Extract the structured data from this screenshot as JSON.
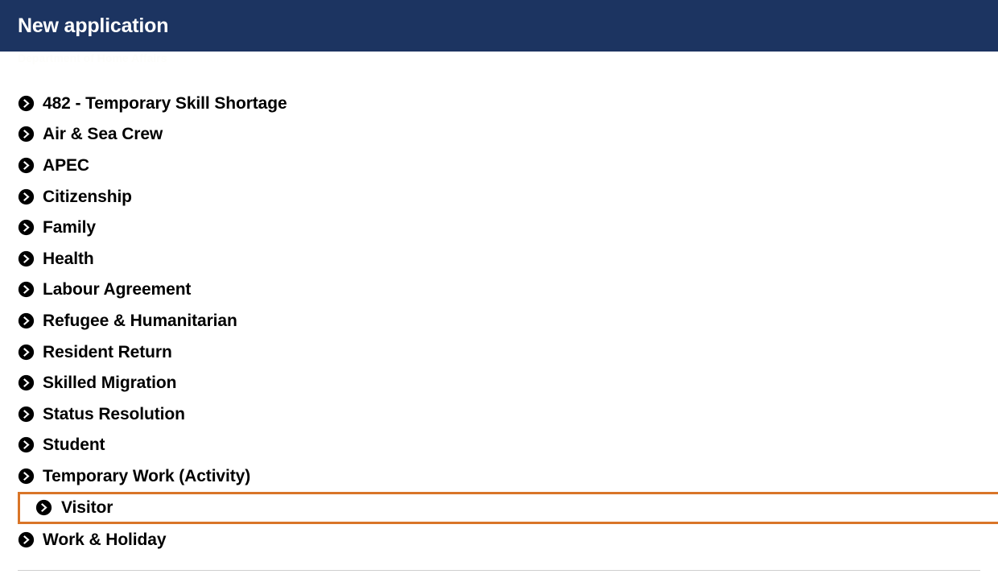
{
  "header": {
    "title": "New application",
    "background_color": "#1c3461",
    "text_color": "#ffffff"
  },
  "watermark": {
    "text": "Department of Home Affairs"
  },
  "main": {
    "focus_color": "#d97528",
    "divider_color": "#cfcfcf",
    "icon_name": "chevron-right-circle-icon",
    "categories": [
      {
        "label": "482 - Temporary Skill Shortage",
        "focused": false
      },
      {
        "label": "Air & Sea Crew",
        "focused": false
      },
      {
        "label": "APEC",
        "focused": false
      },
      {
        "label": "Citizenship",
        "focused": false
      },
      {
        "label": "Family",
        "focused": false
      },
      {
        "label": "Health",
        "focused": false
      },
      {
        "label": "Labour Agreement",
        "focused": false
      },
      {
        "label": "Refugee & Humanitarian",
        "focused": false
      },
      {
        "label": "Resident Return",
        "focused": false
      },
      {
        "label": "Skilled Migration",
        "focused": false
      },
      {
        "label": "Status Resolution",
        "focused": false
      },
      {
        "label": "Student",
        "focused": false
      },
      {
        "label": "Temporary Work (Activity)",
        "focused": false
      },
      {
        "label": "Visitor",
        "focused": true
      },
      {
        "label": "Work & Holiday",
        "focused": false
      }
    ]
  }
}
